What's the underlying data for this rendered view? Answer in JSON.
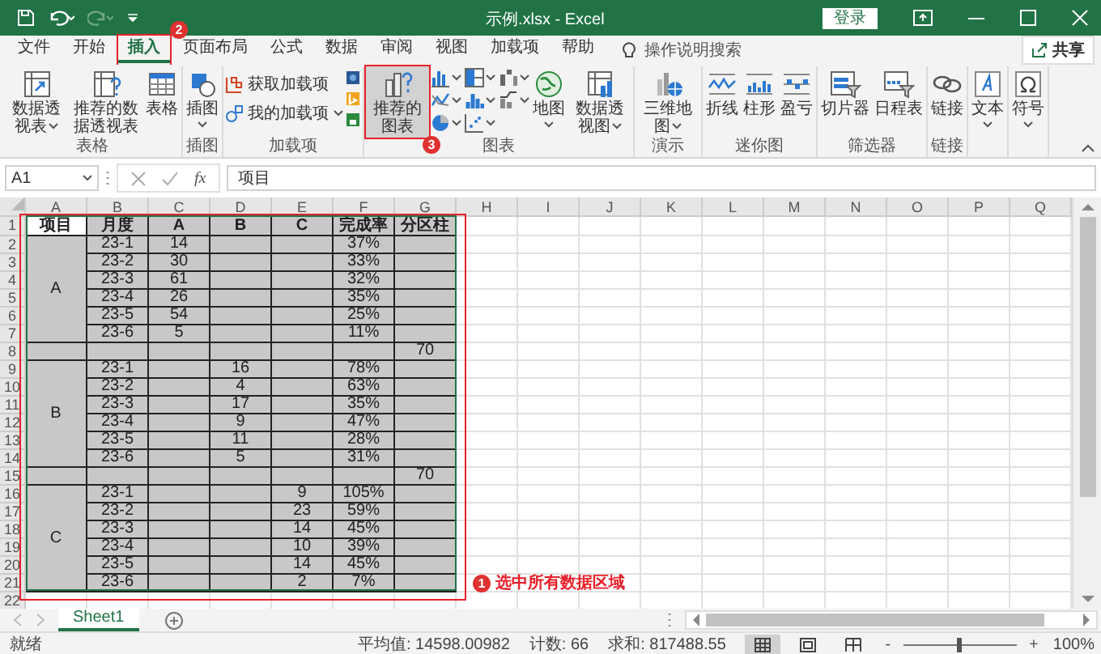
{
  "window": {
    "title": "示例.xlsx - Excel",
    "login_button": "登录"
  },
  "quick_access": [
    {
      "kind": "save",
      "disabled": false
    },
    {
      "kind": "undo",
      "disabled": false
    },
    {
      "kind": "redo",
      "disabled": true
    },
    {
      "kind": "customize",
      "disabled": false
    }
  ],
  "menu_tabs": [
    {
      "label": "文件",
      "selected": false
    },
    {
      "label": "开始",
      "selected": false
    },
    {
      "label": "插入",
      "selected": true,
      "badge": "2"
    },
    {
      "label": "页面布局",
      "selected": false
    },
    {
      "label": "公式",
      "selected": false
    },
    {
      "label": "数据",
      "selected": false
    },
    {
      "label": "审阅",
      "selected": false
    },
    {
      "label": "视图",
      "selected": false
    },
    {
      "label": "加载项",
      "selected": false
    },
    {
      "label": "帮助",
      "selected": false
    }
  ],
  "tell_me": "操作说明搜索",
  "share_button": "共享",
  "ribbon_groups": [
    {
      "kind": "large",
      "label": "表格",
      "buttons": [
        {
          "kind": "pivot-table",
          "label": "数据透视表",
          "dropdown": true
        },
        {
          "kind": "recommended-pivot",
          "label": "推荐的数据透视表",
          "dropdown": false
        },
        {
          "kind": "table",
          "label": "表格",
          "dropdown": false
        }
      ]
    },
    {
      "kind": "large",
      "label": "插图",
      "buttons": [
        {
          "kind": "illustrations",
          "label": "插图",
          "dropdown": true
        }
      ]
    },
    {
      "kind": "addins",
      "label": "加载项",
      "buttons": [
        {
          "kind": "store",
          "label": "获取加载项",
          "dropdown": false
        },
        {
          "kind": "my-addins",
          "label": "我的加载项",
          "dropdown": true
        }
      ],
      "apps": [
        {
          "kind": "visio"
        },
        {
          "kind": "bing"
        },
        {
          "kind": "people"
        }
      ]
    },
    {
      "kind": "charts",
      "label": "图表",
      "buttons": [
        {
          "kind": "recommended-charts",
          "label": "推荐的图表",
          "dropdown": false,
          "highlighted": true,
          "badge": "3"
        }
      ],
      "gallery": [
        {
          "kind": "column"
        },
        {
          "kind": "hierarchy"
        },
        {
          "kind": "waterfall"
        },
        {
          "kind": "line"
        },
        {
          "kind": "statistic"
        },
        {
          "kind": "combo"
        },
        {
          "kind": "pie"
        },
        {
          "kind": "scatter"
        }
      ],
      "extra": [
        {
          "kind": "map",
          "label": "地图",
          "dropdown": true
        },
        {
          "kind": "pivot-chart",
          "label": "数据透视图",
          "dropdown": true
        }
      ]
    },
    {
      "kind": "large",
      "label": "演示",
      "buttons": [
        {
          "kind": "globe3d",
          "label": "三维地图",
          "dropdown": true
        }
      ]
    },
    {
      "kind": "large",
      "label": "迷你图",
      "buttons": [
        {
          "kind": "sparkline-line",
          "label": "折线",
          "dropdown": false
        },
        {
          "kind": "sparkline-column",
          "label": "柱形",
          "dropdown": false
        },
        {
          "kind": "sparkline-winloss",
          "label": "盈亏",
          "dropdown": false
        }
      ]
    },
    {
      "kind": "large",
      "label": "筛选器",
      "buttons": [
        {
          "kind": "slicer",
          "label": "切片器",
          "dropdown": false
        },
        {
          "kind": "timeline",
          "label": "日程表",
          "dropdown": false
        }
      ]
    },
    {
      "kind": "large",
      "label": "链接",
      "buttons": [
        {
          "kind": "link",
          "label": "链接",
          "dropdown": false
        }
      ]
    },
    {
      "kind": "large",
      "buttons": [
        {
          "kind": "text",
          "label": "文本",
          "dropdown": true
        }
      ]
    },
    {
      "kind": "large",
      "buttons": [
        {
          "kind": "symbol",
          "label": "符号",
          "dropdown": true
        }
      ]
    }
  ],
  "formula_bar": {
    "name_box": "A1",
    "function_label": "fx",
    "value": "项目"
  },
  "sheet": {
    "columns": [
      "A",
      "B",
      "C",
      "D",
      "E",
      "F",
      "G",
      "H",
      "I",
      "J",
      "K",
      "L",
      "M",
      "N",
      "O",
      "P",
      "Q"
    ],
    "row_numbers": [
      "1",
      "2",
      "3",
      "4",
      "5",
      "6",
      "7",
      "8",
      "9",
      "10",
      "11",
      "12",
      "13",
      "14",
      "15",
      "16",
      "17",
      "18",
      "19",
      "20",
      "21",
      "22"
    ],
    "selected": true,
    "header": [
      "项目",
      "月度",
      "A",
      "B",
      "C",
      "完成率",
      "分区柱"
    ],
    "sections": [
      {
        "kind": "group",
        "label": "A",
        "rows": [
          {
            "month": "23-1",
            "a": "14",
            "rate": "37%"
          },
          {
            "month": "23-2",
            "a": "30",
            "rate": "33%"
          },
          {
            "month": "23-3",
            "a": "61",
            "rate": "32%"
          },
          {
            "month": "23-4",
            "a": "26",
            "rate": "35%"
          },
          {
            "month": "23-5",
            "a": "54",
            "rate": "25%"
          },
          {
            "month": "23-6",
            "a": "5",
            "rate": "11%"
          }
        ]
      },
      {
        "kind": "subtotal",
        "partition": "70"
      },
      {
        "kind": "group",
        "label": "B",
        "rows": [
          {
            "month": "23-1",
            "b": "16",
            "rate": "78%"
          },
          {
            "month": "23-2",
            "b": "4",
            "rate": "63%"
          },
          {
            "month": "23-3",
            "b": "17",
            "rate": "35%"
          },
          {
            "month": "23-4",
            "b": "9",
            "rate": "47%"
          },
          {
            "month": "23-5",
            "b": "11",
            "rate": "28%"
          },
          {
            "month": "23-6",
            "b": "5",
            "rate": "31%"
          }
        ]
      },
      {
        "kind": "subtotal",
        "partition": "70"
      },
      {
        "kind": "group",
        "label": "C",
        "rows": [
          {
            "month": "23-1",
            "c": "9",
            "rate": "105%"
          },
          {
            "month": "23-2",
            "c": "23",
            "rate": "59%"
          },
          {
            "month": "23-3",
            "c": "14",
            "rate": "45%"
          },
          {
            "month": "23-4",
            "c": "10",
            "rate": "39%"
          },
          {
            "month": "23-5",
            "c": "14",
            "rate": "45%"
          },
          {
            "month": "23-6",
            "c": "2",
            "rate": "7%"
          }
        ]
      }
    ],
    "badge": "1",
    "note": "选中所有数据区域"
  },
  "sheet_tabs": [
    {
      "label": "Sheet1",
      "selected": true
    }
  ],
  "status_bar": {
    "ready": "就绪",
    "average": "平均值: 14598.00982",
    "count": "计数: 66",
    "sum": "求和: 817488.55",
    "views": [
      {
        "kind": "normal",
        "selected": true
      },
      {
        "kind": "page-layout",
        "selected": false
      },
      {
        "kind": "page-break",
        "selected": false
      }
    ],
    "zoom": {
      "minus": "-",
      "plus": "+",
      "level": 0.5,
      "label": "100%"
    }
  }
}
